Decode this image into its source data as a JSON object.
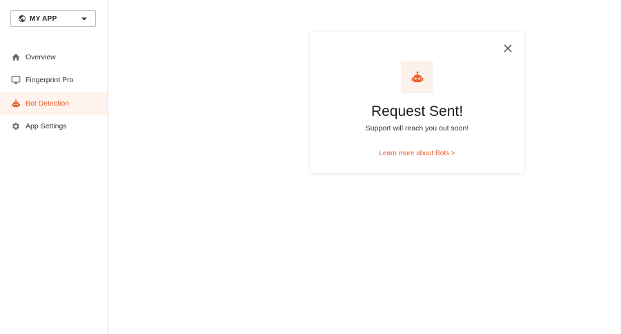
{
  "app_selector": {
    "label": "MY APP",
    "icon": "globe-icon"
  },
  "sidebar": {
    "items": [
      {
        "label": "Overview",
        "icon": "home-icon",
        "active": false
      },
      {
        "label": "Fingerprint Pro",
        "icon": "monitor-icon",
        "active": false
      },
      {
        "label": "Bot Detection",
        "icon": "robot-icon",
        "active": true
      },
      {
        "label": "App Settings",
        "icon": "gear-icon",
        "active": false
      }
    ]
  },
  "modal": {
    "title": "Request Sent!",
    "subtitle": "Support will reach you out soon!",
    "link": "Learn more about Bots >",
    "icon": "robot-icon",
    "close_icon": "close-icon"
  },
  "colors": {
    "accent": "#e8602c",
    "accent_bg": "#fff3ee",
    "icon_grey": "#6f6f6f"
  }
}
